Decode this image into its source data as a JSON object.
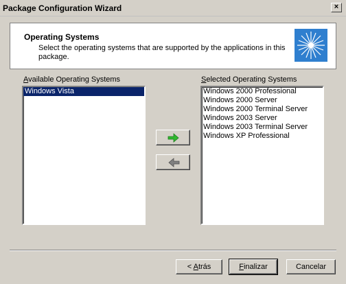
{
  "window": {
    "title": "Package Configuration Wizard",
    "close_glyph": "×"
  },
  "header": {
    "title": "Operating Systems",
    "subtitle": "Select the operating systems that are supported by the applications in this package."
  },
  "available": {
    "label_accel": "A",
    "label_rest": "vailable Operating Systems",
    "items": [
      "Windows Vista"
    ]
  },
  "selected": {
    "label_accel": "S",
    "label_rest": "elected Operating Systems",
    "items": [
      "Windows 2000 Professional",
      "Windows 2000 Server",
      "Windows 2000 Terminal Server",
      "Windows 2003 Server",
      "Windows 2003 Terminal Server",
      "Windows XP Professional"
    ]
  },
  "buttons": {
    "back_prefix": "< ",
    "back_accel": "A",
    "back_rest": "trás",
    "finish_accel": "F",
    "finish_rest": "inalizar",
    "cancel": "Cancelar"
  },
  "colors": {
    "selection": "#0a246a",
    "add_arrow": "#2fb82f",
    "remove_arrow": "#808080",
    "dialog_bg": "#d4d0c8"
  },
  "icons": {
    "add": "right-arrow-icon",
    "remove": "left-arrow-icon",
    "logo": "starburst-logo-icon"
  }
}
